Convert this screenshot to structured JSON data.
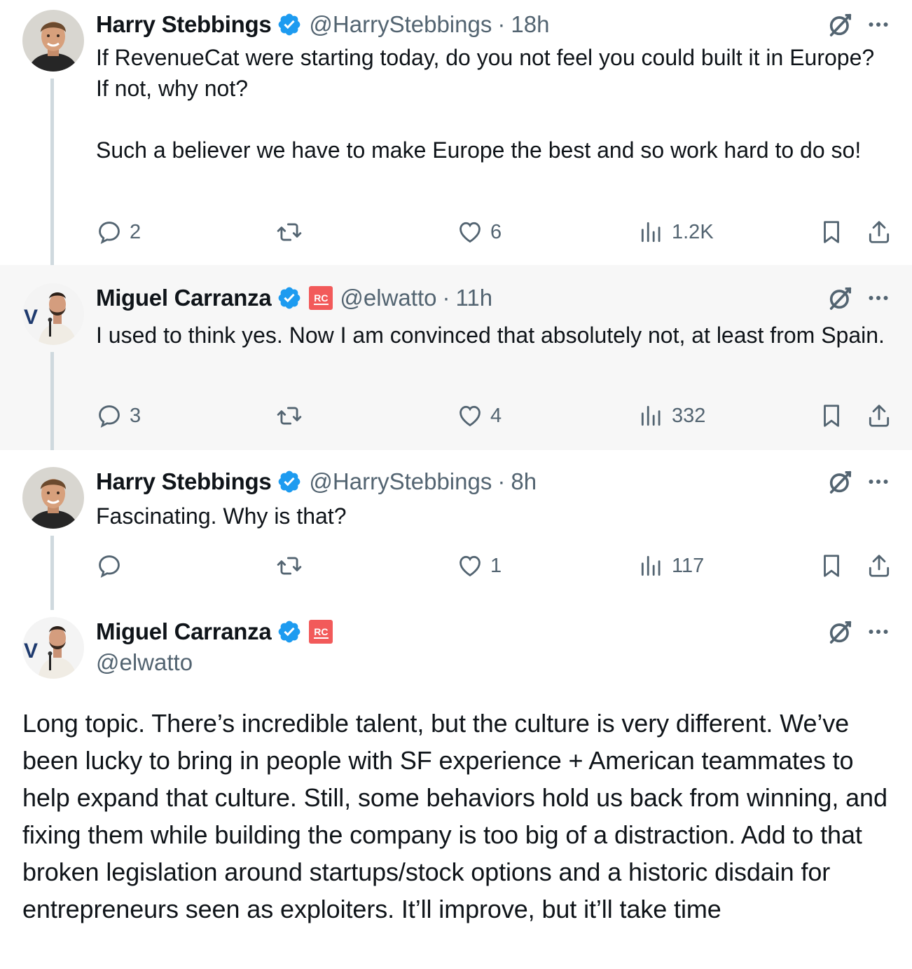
{
  "colors": {
    "verified": "#1d9bf0",
    "affiliation": "#f25a5a",
    "secondary_text": "#536471",
    "thread_line": "#cfd9de",
    "highlight_bg": "#f7f7f7"
  },
  "tweets": [
    {
      "name": "Harry Stebbings",
      "handle": "@HarryStebbings",
      "time": "18h",
      "text": "If RevenueCat were starting today, do you not feel you could built it in Europe? If not, why not?\n\nSuch a believer we have to make Europe the best and so work hard to do so!",
      "replies": "2",
      "retweets": "",
      "likes": "6",
      "views": "1.2K"
    },
    {
      "name": "Miguel Carranza",
      "affiliation_badge": "RC",
      "handle": "@elwatto",
      "time": "11h",
      "text": "I used to think yes. Now I am convinced that absolutely not, at least from Spain.",
      "replies": "3",
      "retweets": "",
      "likes": "4",
      "views": "332"
    },
    {
      "name": "Harry Stebbings",
      "handle": "@HarryStebbings",
      "time": "8h",
      "text": "Fascinating. Why is that?",
      "replies": "",
      "retweets": "",
      "likes": "1",
      "views": "117"
    },
    {
      "name": "Miguel Carranza",
      "affiliation_badge": "RC",
      "handle": "@elwatto",
      "text": "Long topic. There’s incredible talent, but the culture is very different. We’ve been lucky to bring in people with SF experience + American teammates to help expand that culture. Still, some behaviors hold us back from winning, and fixing them while building the company is too big of a distraction. Add to that broken legislation around startups/stock options and a historic disdain for entrepreneurs seen as exploiters. It’ll improve, but it’ll take time"
    }
  ],
  "separator": "·",
  "icons": [
    "verified-badge-icon",
    "grok-icon",
    "more-icon",
    "reply-icon",
    "retweet-icon",
    "like-icon",
    "views-icon",
    "bookmark-icon",
    "share-icon"
  ]
}
